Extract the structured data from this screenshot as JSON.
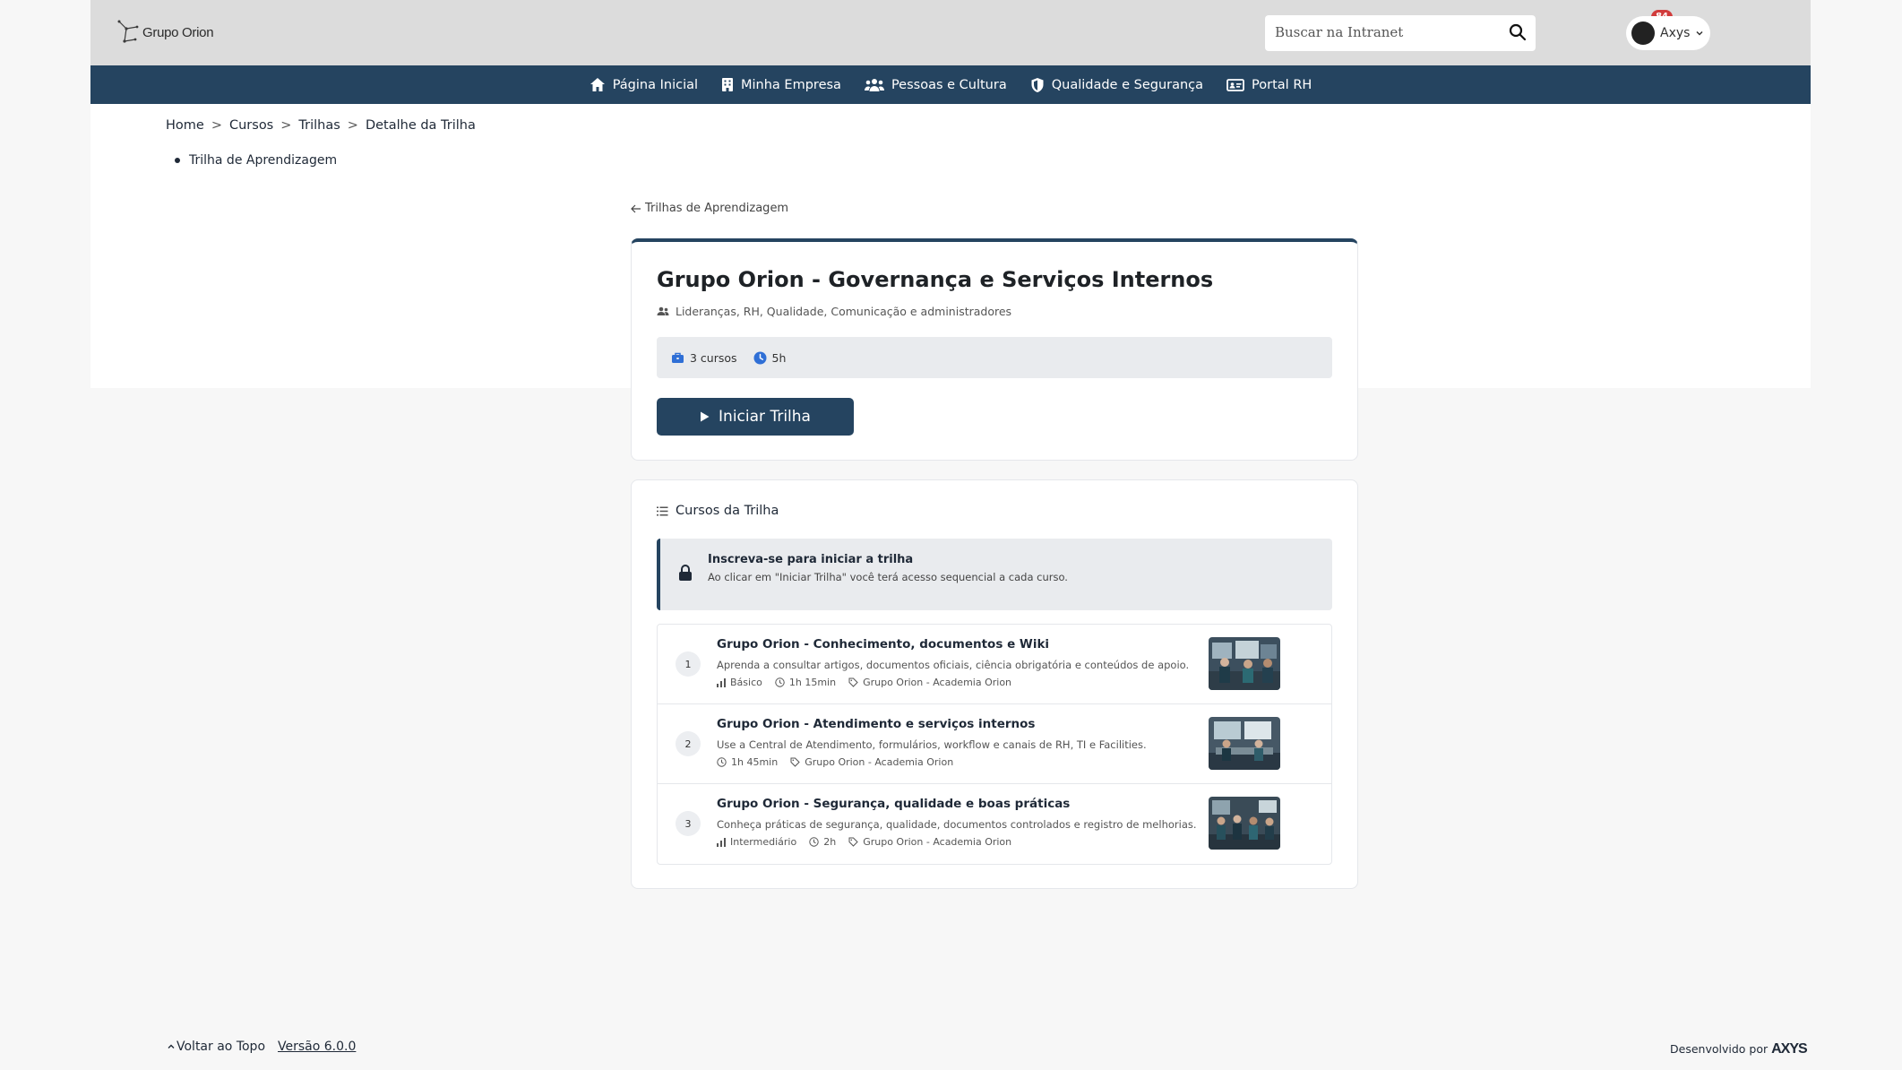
{
  "header": {
    "logo_text": "Grupo Orion",
    "search_placeholder": "Buscar na Intranet",
    "notification_count": "84",
    "user_name": "Axys"
  },
  "nav": {
    "items": [
      {
        "label": "Página Inicial",
        "icon": "home-icon"
      },
      {
        "label": "Minha Empresa",
        "icon": "building-icon"
      },
      {
        "label": "Pessoas e Cultura",
        "icon": "people-icon"
      },
      {
        "label": "Qualidade e Segurança",
        "icon": "shield-icon"
      },
      {
        "label": "Portal RH",
        "icon": "id-card-icon"
      }
    ]
  },
  "breadcrumb": {
    "items": [
      "Home",
      "Cursos",
      "Trilhas",
      "Detalhe da Trilha"
    ],
    "separator": ">",
    "sub_item": "Trilha de Aprendizagem"
  },
  "back_link": "Trilhas de Aprendizagem",
  "trail": {
    "title": "Grupo Orion - Governança e Serviços Internos",
    "audience": "Lideranças, RH, Qualidade, Comunicação e administradores",
    "course_count": "3 cursos",
    "duration": "5h",
    "start_label": "Iniciar Trilha",
    "accent_color": "#254460"
  },
  "courses_section": {
    "title": "Cursos da Trilha",
    "notice_title": "Inscreva-se para iniciar a trilha",
    "notice_text": "Ao clicar em \"Iniciar Trilha\" você terá acesso sequencial a cada curso.",
    "courses": [
      {
        "number": "1",
        "title": "Grupo Orion - Conhecimento, documentos e Wiki",
        "description": "Aprenda a consultar artigos, documentos oficiais, ciência obrigatória e conteúdos de apoio.",
        "level": "Básico",
        "duration": "1h 15min",
        "tag": "Grupo Orion - Academia Orion"
      },
      {
        "number": "2",
        "title": "Grupo Orion - Atendimento e serviços internos",
        "description": "Use a Central de Atendimento, formulários, workflow e canais de RH, TI e Facilities.",
        "level": "",
        "duration": "1h 45min",
        "tag": "Grupo Orion - Academia Orion"
      },
      {
        "number": "3",
        "title": "Grupo Orion - Segurança, qualidade e boas práticas",
        "description": "Conheça práticas de segurança, qualidade, documentos controlados e registro de melhorias.",
        "level": "Intermediário",
        "duration": "2h",
        "tag": "Grupo Orion - Academia Orion"
      }
    ]
  },
  "footer": {
    "back_to_top": "Voltar ao Topo",
    "version": "Versão 6.0.0",
    "developed_by": "Desenvolvido por",
    "brand": "AXYS"
  }
}
